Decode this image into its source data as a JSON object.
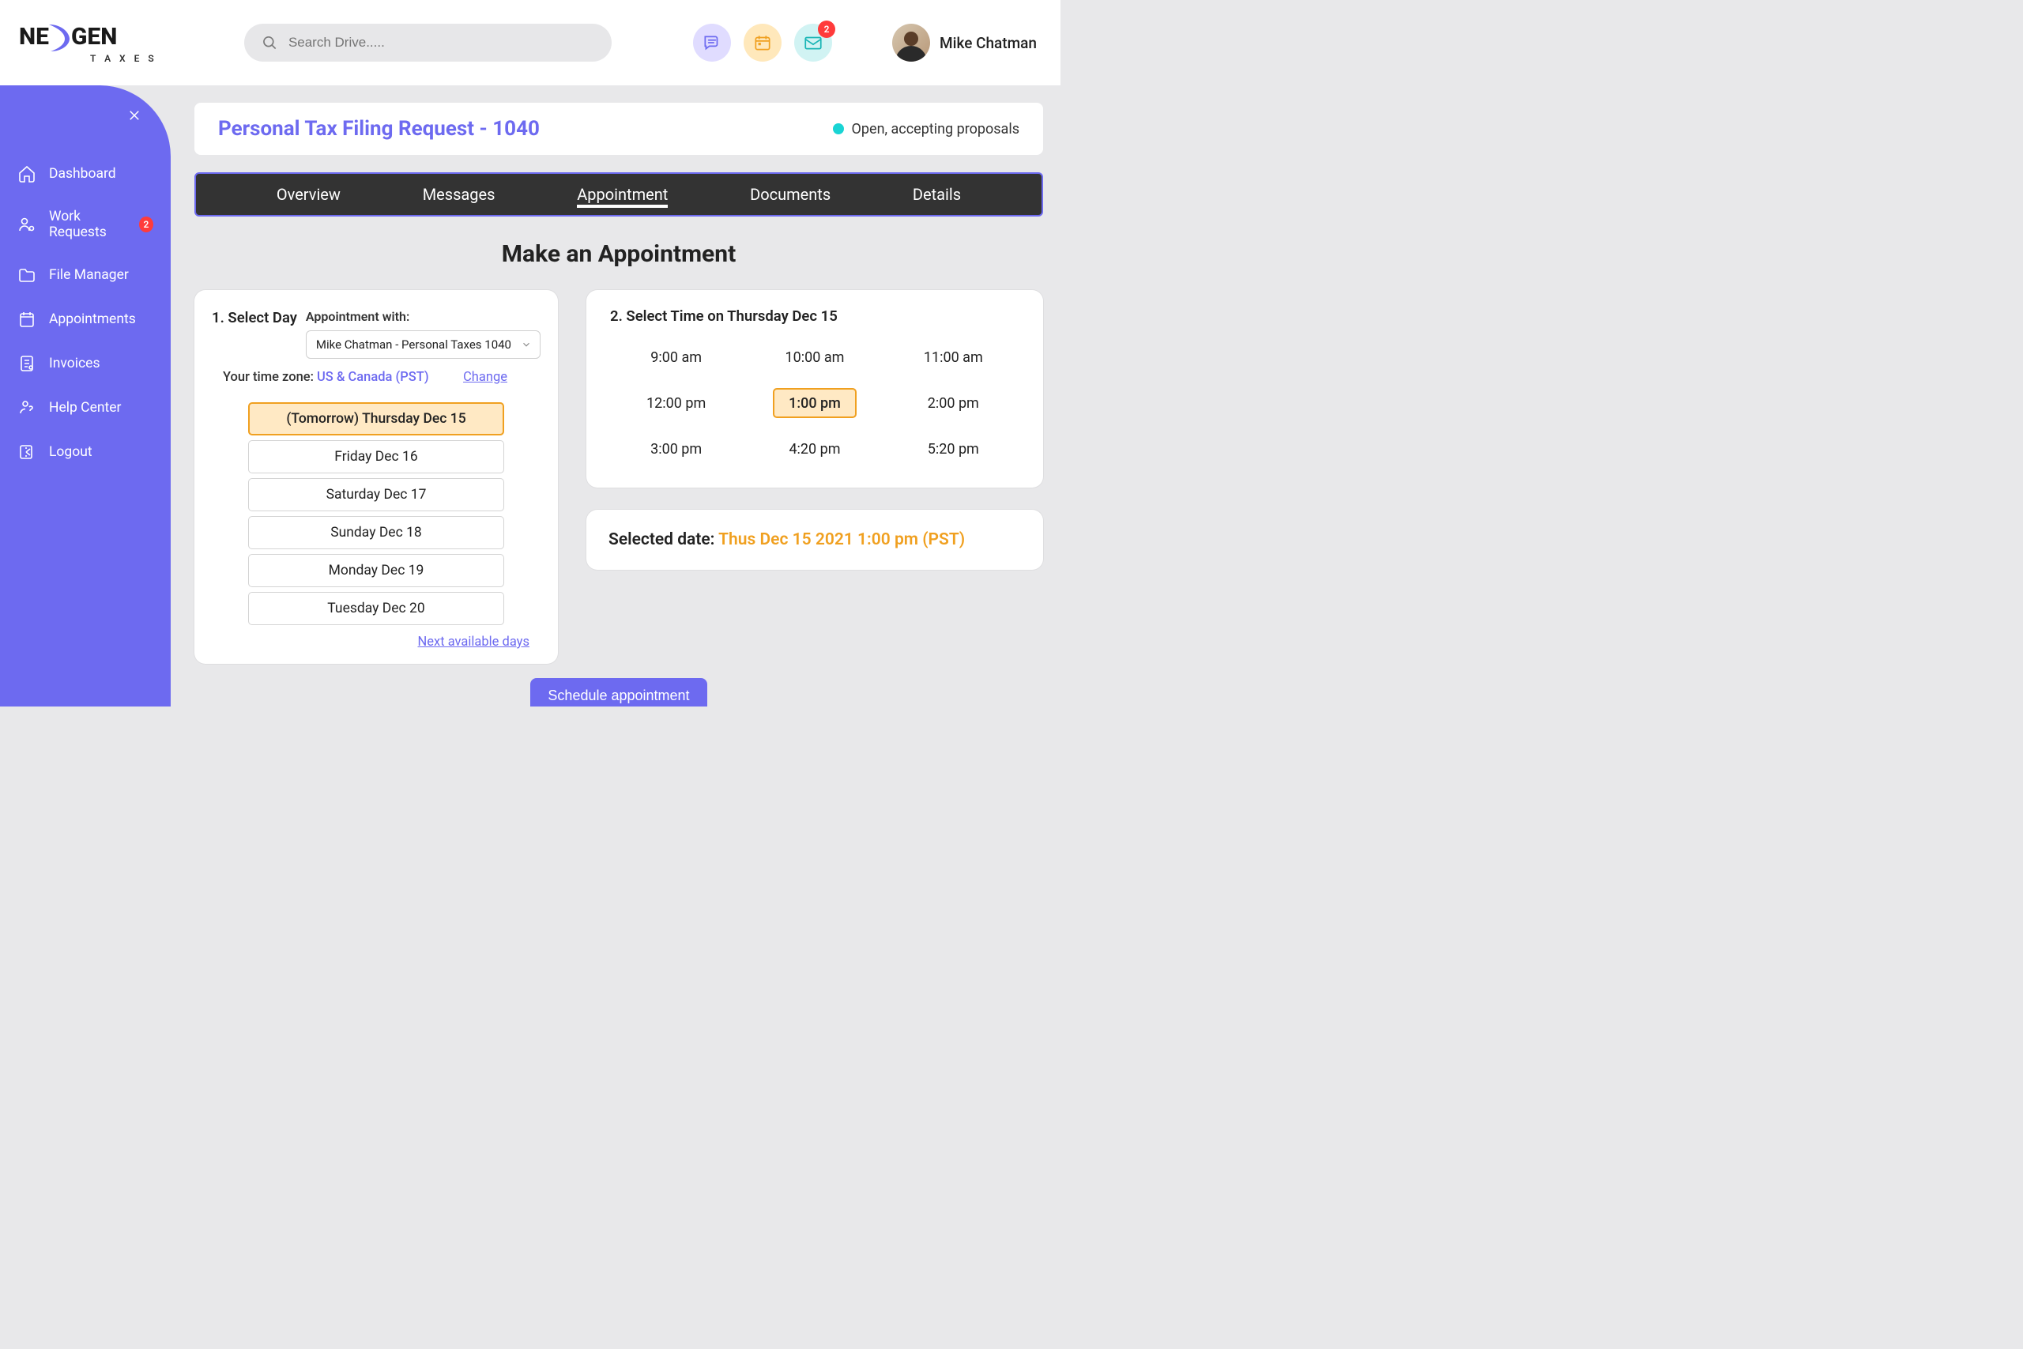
{
  "header": {
    "brand_main_a": "NE",
    "brand_main_b": "GEN",
    "brand_sub": "T A X E S",
    "search_placeholder": "Search Drive....."
  },
  "notifications": {
    "mail_badge": "2"
  },
  "user": {
    "name": "Mike Chatman"
  },
  "sidebar": {
    "items": [
      {
        "label": "Dashboard",
        "badge": null
      },
      {
        "label": "Work Requests",
        "badge": "2"
      },
      {
        "label": "File Manager",
        "badge": null
      },
      {
        "label": "Appointments",
        "badge": null
      },
      {
        "label": "Invoices",
        "badge": null
      },
      {
        "label": "Help Center",
        "badge": null
      },
      {
        "label": "Logout",
        "badge": null
      }
    ]
  },
  "page": {
    "title": "Personal Tax Filing Request - 1040",
    "status": "Open, accepting proposals"
  },
  "tabs": [
    "Overview",
    "Messages",
    "Appointment",
    "Documents",
    "Details"
  ],
  "section": {
    "heading": "Make an Appointment"
  },
  "day_card": {
    "step": "1. Select Day",
    "with_label": "Appointment with:",
    "with_value": "Mike Chatman - Personal Taxes 1040",
    "tz_prefix": "Your time zone:",
    "tz_value": "US & Canada (PST)",
    "tz_change": "Change",
    "days": [
      "(Tomorrow) Thursday Dec 15",
      "Friday Dec 16",
      "Saturday Dec 17",
      "Sunday Dec 18",
      "Monday Dec 19",
      "Tuesday Dec 20"
    ],
    "next_link": "Next available days"
  },
  "time_card": {
    "step": "2. Select Time on Thursday Dec 15",
    "times": [
      "9:00 am",
      "10:00 am",
      "11:00 am",
      "12:00 pm",
      "1:00 pm",
      "2:00 pm",
      "3:00 pm",
      "4:20 pm",
      "5:20 pm"
    ]
  },
  "selected": {
    "prefix": "Selected date: ",
    "value": "Thus Dec 15  2021 1:00 pm (PST)"
  },
  "actions": {
    "schedule": "Schedule appointment"
  }
}
